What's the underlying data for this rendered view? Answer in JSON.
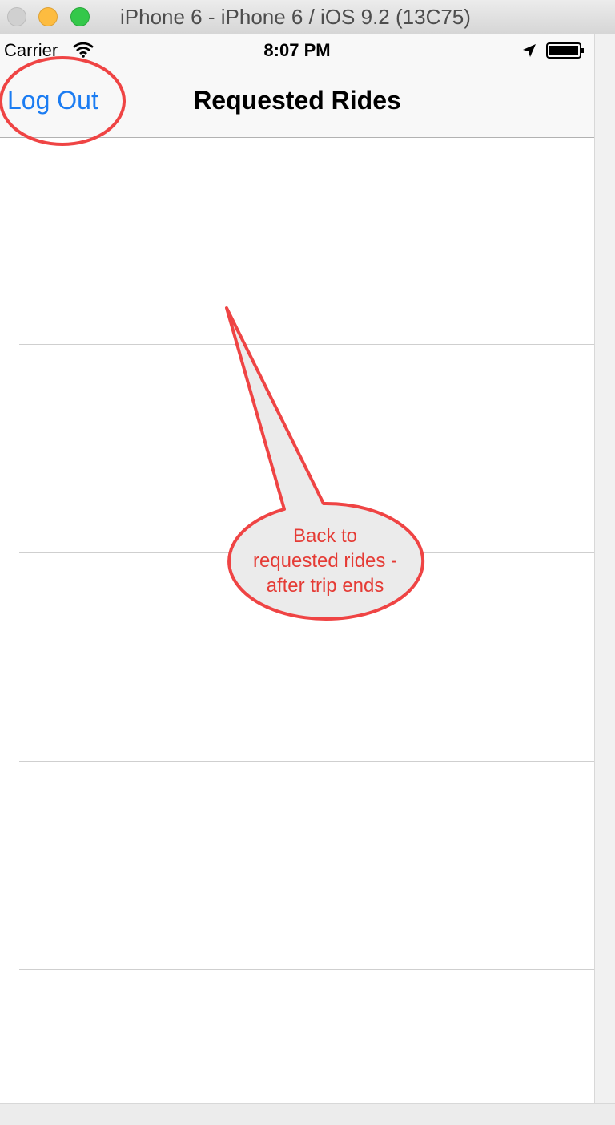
{
  "window": {
    "title": "iPhone 6 - iPhone 6 / iOS 9.2 (13C75)"
  },
  "status_bar": {
    "carrier": "Carrier",
    "time": "8:07 PM"
  },
  "nav": {
    "left_button": "Log Out",
    "title": "Requested Rides"
  },
  "annotation": {
    "lines": [
      "Back to",
      "requested rides -",
      "after trip ends"
    ],
    "color": "#e53b35"
  },
  "colors": {
    "link": "#1b7cf2",
    "annotation_red": "#e53b35"
  },
  "table": {
    "rows": 6
  }
}
